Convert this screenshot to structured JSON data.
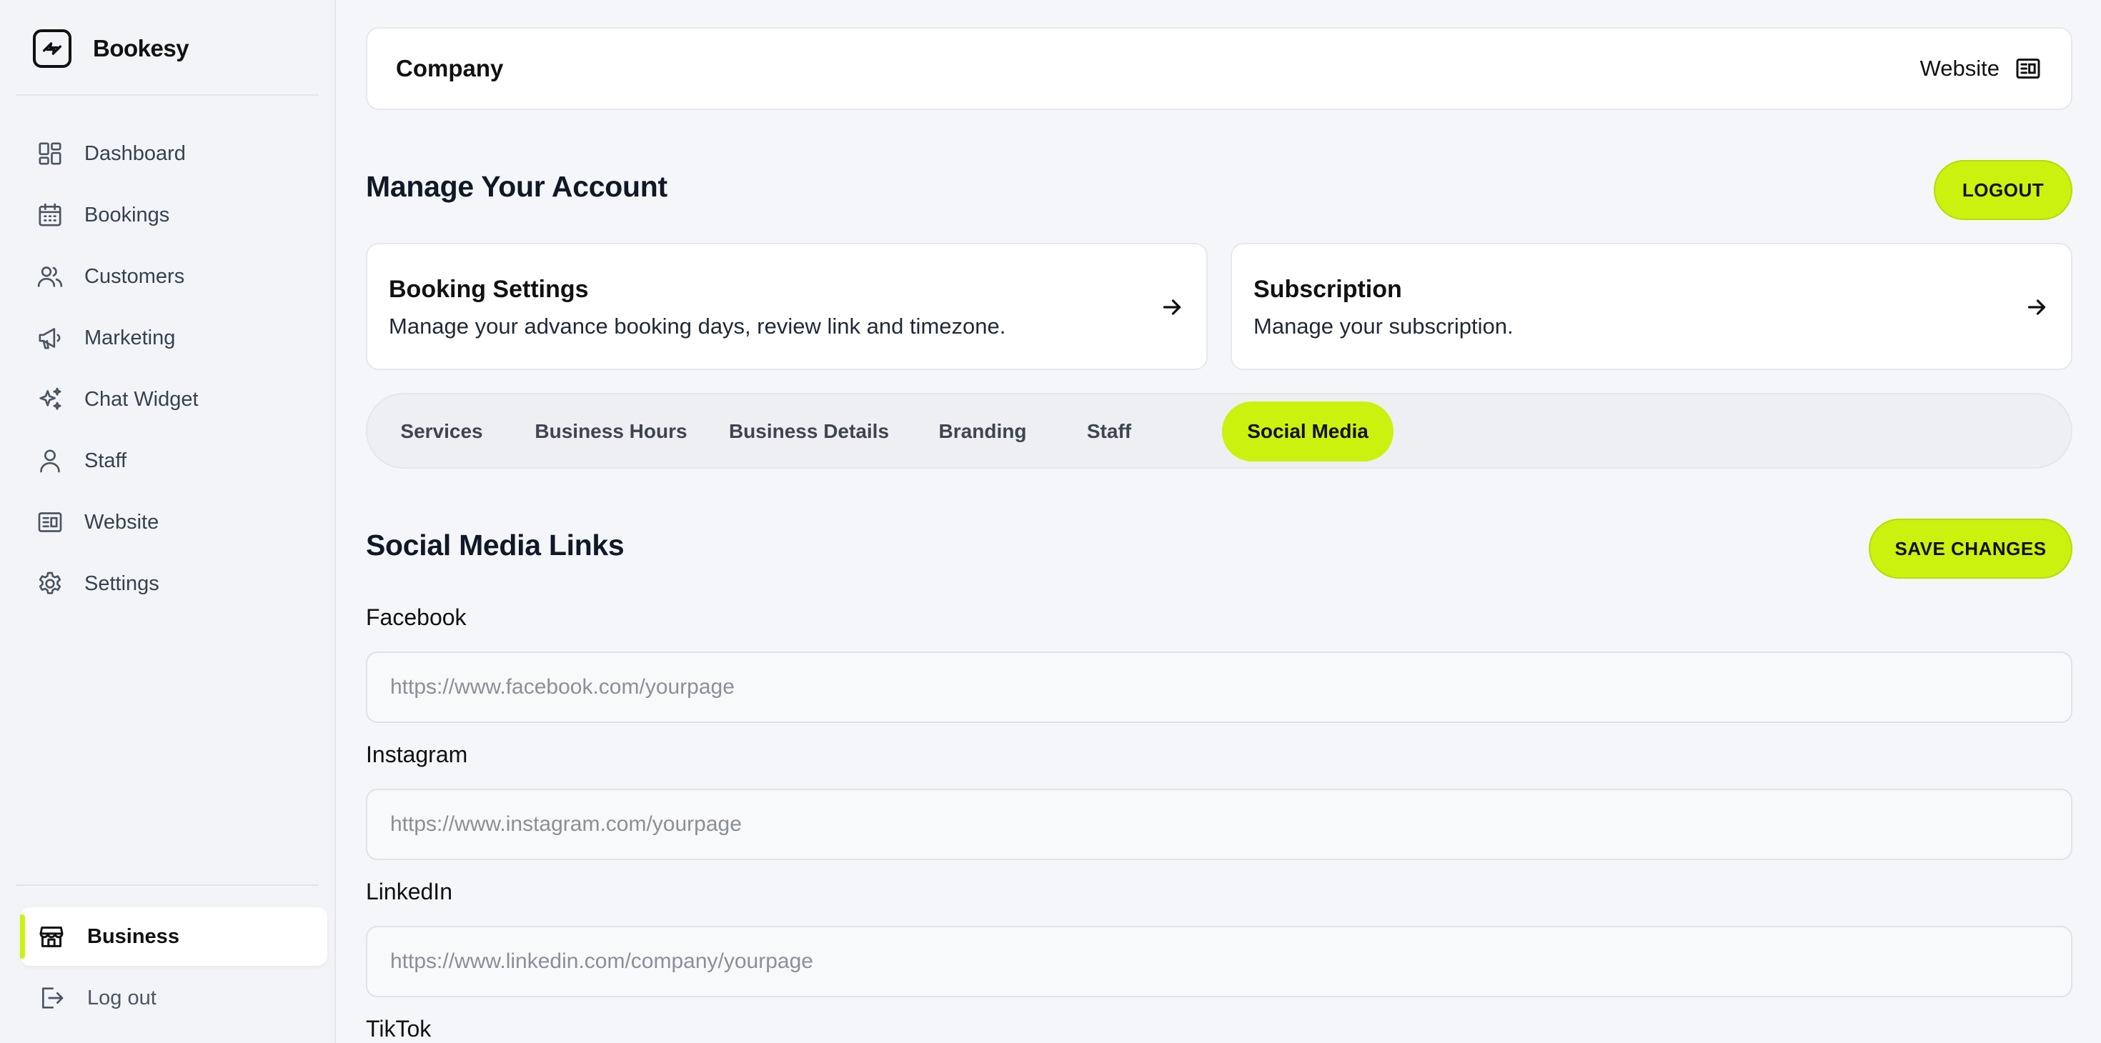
{
  "brand": {
    "name": "Bookesy"
  },
  "sidebar": {
    "items": [
      {
        "label": "Dashboard",
        "icon": "dashboard-icon"
      },
      {
        "label": "Bookings",
        "icon": "calendar-icon"
      },
      {
        "label": "Customers",
        "icon": "users-icon"
      },
      {
        "label": "Marketing",
        "icon": "megaphone-icon"
      },
      {
        "label": "Chat Widget",
        "icon": "sparkles-icon"
      },
      {
        "label": "Staff",
        "icon": "user-icon"
      },
      {
        "label": "Website",
        "icon": "newspaper-icon"
      },
      {
        "label": "Settings",
        "icon": "gear-icon"
      }
    ],
    "business": {
      "label": "Business",
      "icon": "storefront-icon"
    },
    "logout": {
      "label": "Log out",
      "icon": "logout-icon"
    }
  },
  "header": {
    "title": "Company",
    "website_label": "Website"
  },
  "account": {
    "title": "Manage Your Account",
    "logout_label": "LOGOUT",
    "cards": [
      {
        "title": "Booking Settings",
        "description": "Manage your advance booking days, review link and timezone."
      },
      {
        "title": "Subscription",
        "description": "Manage your subscription."
      }
    ]
  },
  "tabs": {
    "items": [
      "Services",
      "Business Hours",
      "Business Details",
      "Branding",
      "Staff",
      "Social Media"
    ],
    "active": "Social Media"
  },
  "social": {
    "title": "Social Media Links",
    "save_label": "SAVE CHANGES",
    "fields": [
      {
        "label": "Facebook",
        "value": "",
        "placeholder": "https://www.facebook.com/yourpage"
      },
      {
        "label": "Instagram",
        "value": "",
        "placeholder": "https://www.instagram.com/yourpage"
      },
      {
        "label": "LinkedIn",
        "value": "",
        "placeholder": "https://www.linkedin.com/company/yourpage"
      },
      {
        "label": "TikTok"
      }
    ]
  },
  "colors": {
    "accent": "#cbf20e",
    "background": "#f5f6f9",
    "sidebar": "#f3f4f7"
  }
}
